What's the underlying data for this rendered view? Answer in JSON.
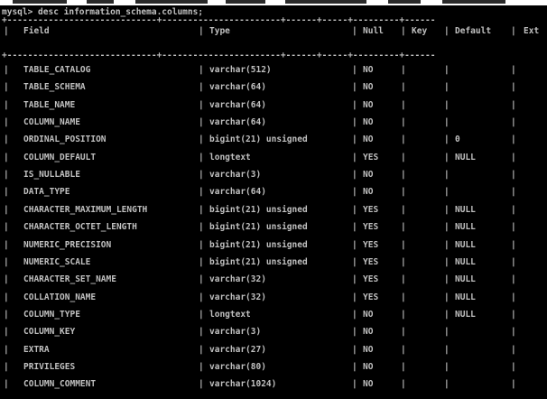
{
  "prompt": "mysql> desc information_schema.columns;",
  "columns": [
    "Field",
    "Type",
    "Null",
    "Key",
    "Default",
    "Extra"
  ],
  "header_extra_visible": "Ext",
  "rows": [
    {
      "field": "TABLE_CATALOG",
      "type": "varchar(512)",
      "null": "NO",
      "key": "",
      "default": ""
    },
    {
      "field": "TABLE_SCHEMA",
      "type": "varchar(64)",
      "null": "NO",
      "key": "",
      "default": ""
    },
    {
      "field": "TABLE_NAME",
      "type": "varchar(64)",
      "null": "NO",
      "key": "",
      "default": ""
    },
    {
      "field": "COLUMN_NAME",
      "type": "varchar(64)",
      "null": "NO",
      "key": "",
      "default": ""
    },
    {
      "field": "ORDINAL_POSITION",
      "type": "bigint(21) unsigned",
      "null": "NO",
      "key": "",
      "default": "0"
    },
    {
      "field": "COLUMN_DEFAULT",
      "type": "longtext",
      "null": "YES",
      "key": "",
      "default": "NULL"
    },
    {
      "field": "IS_NULLABLE",
      "type": "varchar(3)",
      "null": "NO",
      "key": "",
      "default": ""
    },
    {
      "field": "DATA_TYPE",
      "type": "varchar(64)",
      "null": "NO",
      "key": "",
      "default": ""
    },
    {
      "field": "CHARACTER_MAXIMUM_LENGTH",
      "type": "bigint(21) unsigned",
      "null": "YES",
      "key": "",
      "default": "NULL"
    },
    {
      "field": "CHARACTER_OCTET_LENGTH",
      "type": "bigint(21) unsigned",
      "null": "YES",
      "key": "",
      "default": "NULL"
    },
    {
      "field": "NUMERIC_PRECISION",
      "type": "bigint(21) unsigned",
      "null": "YES",
      "key": "",
      "default": "NULL"
    },
    {
      "field": "NUMERIC_SCALE",
      "type": "bigint(21) unsigned",
      "null": "YES",
      "key": "",
      "default": "NULL"
    },
    {
      "field": "CHARACTER_SET_NAME",
      "type": "varchar(32)",
      "null": "YES",
      "key": "",
      "default": "NULL"
    },
    {
      "field": "COLLATION_NAME",
      "type": "varchar(32)",
      "null": "YES",
      "key": "",
      "default": "NULL"
    },
    {
      "field": "COLUMN_TYPE",
      "type": "longtext",
      "null": "NO",
      "key": "",
      "default": "NULL"
    },
    {
      "field": "COLUMN_KEY",
      "type": "varchar(3)",
      "null": "NO",
      "key": "",
      "default": ""
    },
    {
      "field": "EXTRA",
      "type": "varchar(27)",
      "null": "NO",
      "key": "",
      "default": ""
    },
    {
      "field": "PRIVILEGES",
      "type": "varchar(80)",
      "null": "NO",
      "key": "",
      "default": ""
    },
    {
      "field": "COLUMN_COMMENT",
      "type": "varchar(1024)",
      "null": "NO",
      "key": "",
      "default": ""
    }
  ],
  "colors": {
    "background": "#000000",
    "text": "#c0c0c0"
  }
}
